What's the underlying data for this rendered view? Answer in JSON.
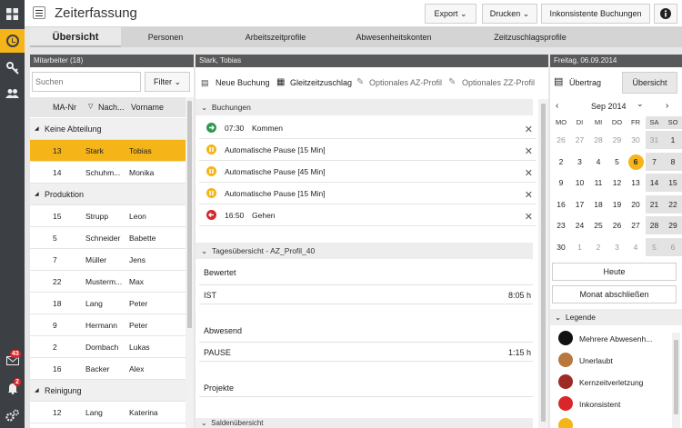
{
  "app": {
    "title": "Zeiterfassung"
  },
  "toolbar": {
    "export": "Export",
    "drucken": "Drucken",
    "inkonsistent": "Inkonsistente Buchungen"
  },
  "tabs": [
    "Übersicht",
    "Personen",
    "Arbeitszeitprofile",
    "Abwesenheitskonten",
    "Zeitzuschlagsprofile"
  ],
  "rail": {
    "mail_count": "43",
    "bell_count": "2"
  },
  "employees": {
    "header": "Mitarbeiter (18)",
    "search_placeholder": "Suchen",
    "filter": "Filter",
    "col_nr": "MA-Nr",
    "col_name": "Nach...",
    "col_vorname": "Vorname",
    "groups": [
      {
        "name": "Keine Abteilung",
        "rows": [
          {
            "nr": "13",
            "name": "Stark",
            "vorname": "Tobias"
          },
          {
            "nr": "14",
            "name": "Schuhm...",
            "vorname": "Monika"
          }
        ]
      },
      {
        "name": "Produktion",
        "rows": [
          {
            "nr": "15",
            "name": "Strupp",
            "vorname": "Leon"
          },
          {
            "nr": "5",
            "name": "Schneider",
            "vorname": "Babette"
          },
          {
            "nr": "7",
            "name": "Müller",
            "vorname": "Jens"
          },
          {
            "nr": "22",
            "name": "Musterm...",
            "vorname": "Max"
          },
          {
            "nr": "18",
            "name": "Lang",
            "vorname": "Peter"
          },
          {
            "nr": "9",
            "name": "Hermann",
            "vorname": "Peter"
          },
          {
            "nr": "2",
            "name": "Dombach",
            "vorname": "Lukas"
          },
          {
            "nr": "16",
            "name": "Backer",
            "vorname": "Alex"
          }
        ]
      },
      {
        "name": "Reinigung",
        "rows": [
          {
            "nr": "12",
            "name": "Lang",
            "vorname": "Katerina"
          }
        ]
      }
    ]
  },
  "booking": {
    "header": "Stark, Tobias",
    "actions": [
      "Neue Buchung",
      "Gleitzeitzuschlag",
      "Optionales AZ-Profil",
      "Optionales ZZ-Profil"
    ],
    "section": "Buchungen",
    "items": [
      {
        "time": "07:30",
        "label": "Kommen",
        "kind": "in"
      },
      {
        "time": "",
        "label": "Automatische Pause  [15 Min]",
        "kind": "pause"
      },
      {
        "time": "",
        "label": "Automatische Pause  [45 Min]",
        "kind": "pause"
      },
      {
        "time": "",
        "label": "Automatische Pause  [15 Min]",
        "kind": "pause"
      },
      {
        "time": "16:50",
        "label": "Gehen",
        "kind": "out"
      }
    ],
    "summary_title": "Tagesübersicht - AZ_Profil_40",
    "bewertet": "Bewertet",
    "ist_label": "IST",
    "ist_value": "8:05 h",
    "abwesend": "Abwesend",
    "pause_label": "PAUSE",
    "pause_value": "1:15 h",
    "projekte": "Projekte",
    "saldo": "Saldenübersicht"
  },
  "calendar": {
    "header": "Freitag, 06.09.2014",
    "uebertrag": "Übertrag",
    "uebersicht": "Übersicht",
    "month": "Sep 2014",
    "weekdays": [
      "MO",
      "DI",
      "MI",
      "DO",
      "FR",
      "SA",
      "SO"
    ],
    "weeks": [
      [
        "26",
        "27",
        "28",
        "29",
        "30",
        "31",
        "1"
      ],
      [
        "2",
        "3",
        "4",
        "5",
        "6",
        "7",
        "8"
      ],
      [
        "9",
        "10",
        "11",
        "12",
        "13",
        "14",
        "15"
      ],
      [
        "16",
        "17",
        "18",
        "19",
        "20",
        "21",
        "22"
      ],
      [
        "23",
        "24",
        "25",
        "26",
        "27",
        "28",
        "29"
      ],
      [
        "30",
        "1",
        "2",
        "3",
        "4",
        "5",
        "6"
      ]
    ],
    "today": "Heute",
    "close_month": "Monat abschließen",
    "legend_title": "Legende",
    "legend": [
      {
        "label": "Mehrere Abwesenh...",
        "color": "#111111"
      },
      {
        "label": "Unerlaubt",
        "color": "#b8773c"
      },
      {
        "label": "Kernzeitverletzung",
        "color": "#9e2a24"
      },
      {
        "label": "Inkonsistent",
        "color": "#d9262b"
      },
      {
        "label": "",
        "color": "#f5b417"
      }
    ]
  }
}
